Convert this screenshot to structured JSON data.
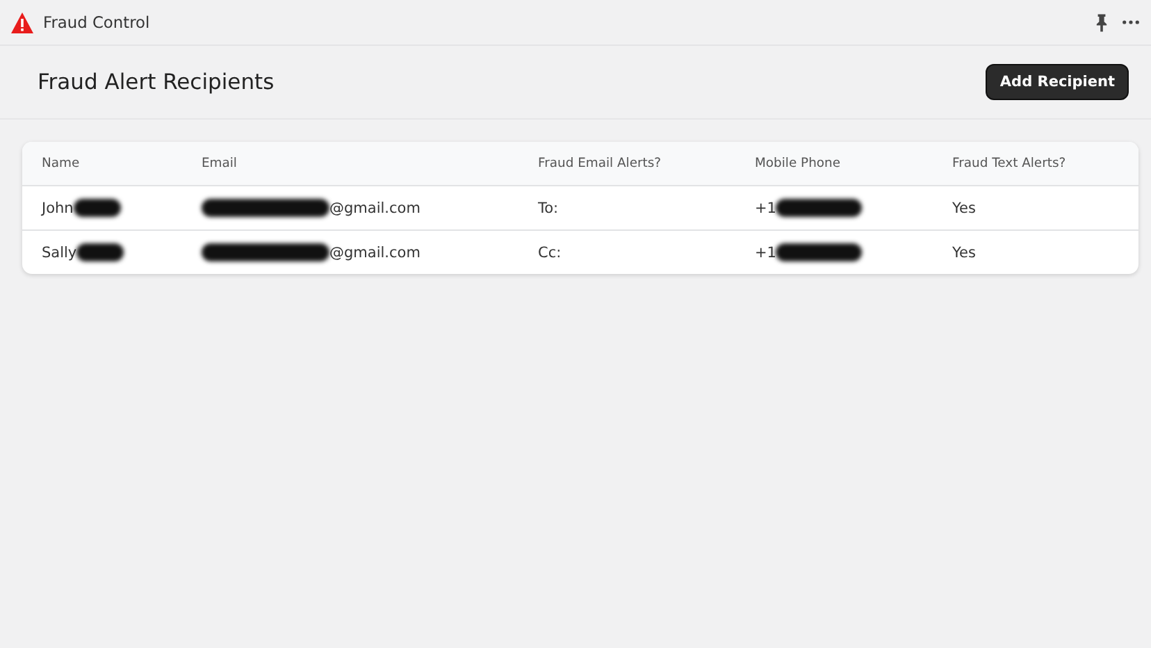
{
  "window": {
    "title": "Fraud Control"
  },
  "header": {
    "title": "Fraud Alert Recipients",
    "button": "Add Recipient"
  },
  "table": {
    "columns": [
      "Name",
      "Email",
      "Fraud Email Alerts?",
      "Mobile Phone",
      "Fraud Text Alerts?"
    ],
    "rows": [
      [
        {
          "before": "John",
          "redacted": true
        },
        {
          "redacted": true,
          "after": "@gmail.com"
        },
        {
          "before": "To:",
          "redacted": false
        },
        {
          "before": "+1",
          "redacted": true
        },
        {
          "before": "Yes",
          "redacted": false
        }
      ],
      [
        {
          "before": "Sally",
          "redacted": true
        },
        {
          "redacted": true,
          "after": "@gmail.com"
        },
        {
          "before": "Cc:",
          "redacted": false
        },
        {
          "before": "+1",
          "redacted": true
        },
        {
          "before": "Yes",
          "redacted": false
        }
      ]
    ]
  }
}
